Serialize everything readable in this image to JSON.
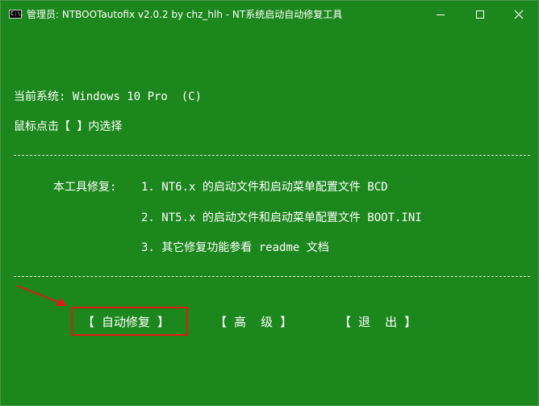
{
  "window": {
    "title": "管理员:  NTBOOTautofix v2.0.2 by chz_hlh - NT系统启动自动修复工具",
    "icon_label": "C:\\."
  },
  "console": {
    "current_system": "当前系统: Windows 10 Pro  (C)",
    "instruction": "鼠标点击【 】内选择",
    "separator": "------------------------------------------------------------------------------------------------",
    "repair_heading": "本工具修复:",
    "repair_items": [
      "1. NT6.x 的启动文件和启动菜单配置文件 BCD",
      "2. NT5.x 的启动文件和启动菜单配置文件 BOOT.INI",
      "3. 其它修复功能参看 readme 文档"
    ]
  },
  "menu": {
    "auto_repair": "【 自动修复 】",
    "advanced": "【 高  级 】",
    "exit": "【 退  出 】"
  },
  "colors": {
    "background": "#1c871c",
    "text": "#ffffff",
    "highlight": "#e11b1b"
  }
}
